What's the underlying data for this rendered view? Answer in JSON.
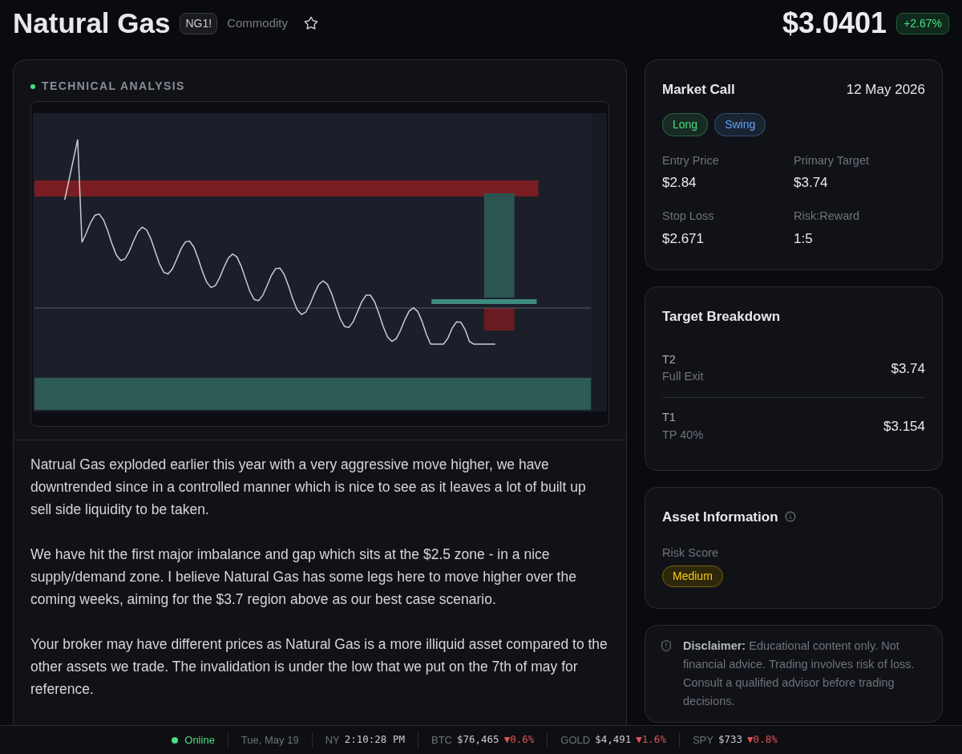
{
  "header": {
    "title": "Natural Gas",
    "symbol": "NG1!",
    "category": "Commodity",
    "favorite": false,
    "price": "$3.0401",
    "change": "+2.67%"
  },
  "analysis": {
    "heading": "TECHNICAL ANALYSIS",
    "chart": {
      "kind": "picture"
    },
    "paragraphs": [
      "Natrual Gas exploded earlier this year with a very aggressive move higher, we have downtrended since in a controlled manner which is nice to see as it leaves a lot of built up sell side liquidity to be taken.",
      "We have hit the first major imbalance and gap which sits at the $2.5 zone - in a nice supply/demand zone. I believe Natural Gas has some legs here to move higher over the coming weeks, aiming for the $3.7 region above as our best case scenario.",
      "Your broker may have different prices as Natural Gas is a more illiquid asset compared to the other assets we trade. The invalidation is under the low that we put on the 7th of may for reference."
    ]
  },
  "market_call": {
    "title": "Market Call",
    "date": "12 May 2026",
    "tags": [
      {
        "label": "Long",
        "color": "#4ade80"
      },
      {
        "label": "Swing",
        "color": "#60a5fa"
      }
    ],
    "stats": [
      {
        "label": "Entry Price",
        "value": "$2.84"
      },
      {
        "label": "Primary Target",
        "value": "$3.74"
      },
      {
        "label": "Stop Loss",
        "value": "$2.671"
      },
      {
        "label": "Risk:Reward",
        "value": "1:5"
      }
    ]
  },
  "target_breakdown": {
    "title": "Target Breakdown",
    "targets": [
      {
        "name": "T2",
        "note": "Full Exit",
        "price": "$3.74"
      },
      {
        "name": "T1",
        "note": "TP 40%",
        "price": "$3.154"
      }
    ]
  },
  "asset_information": {
    "title": "Asset Information",
    "risk_label": "Risk Score",
    "risk_value": "Medium"
  },
  "disclaimer": {
    "text": "**Disclaimer:** Educational content only. Not financial advice. Trading involves risk of loss. Consult a qualified advisor before trading decisions."
  },
  "status_bar": {
    "connection": "Online",
    "online": true,
    "date": "Tue, May 19",
    "clock_label": "NY",
    "clock": "2:10:28 PM",
    "tickers": [
      {
        "symbol": "BTC",
        "price": "$76,465",
        "change": "▼0.6%",
        "color": "#e05555"
      },
      {
        "symbol": "GOLD",
        "price": "$4,491",
        "change": "▼1.6%",
        "color": "#e05555"
      },
      {
        "symbol": "SPY",
        "price": "$733",
        "change": "▼0.8%",
        "color": "#e05555"
      }
    ]
  }
}
